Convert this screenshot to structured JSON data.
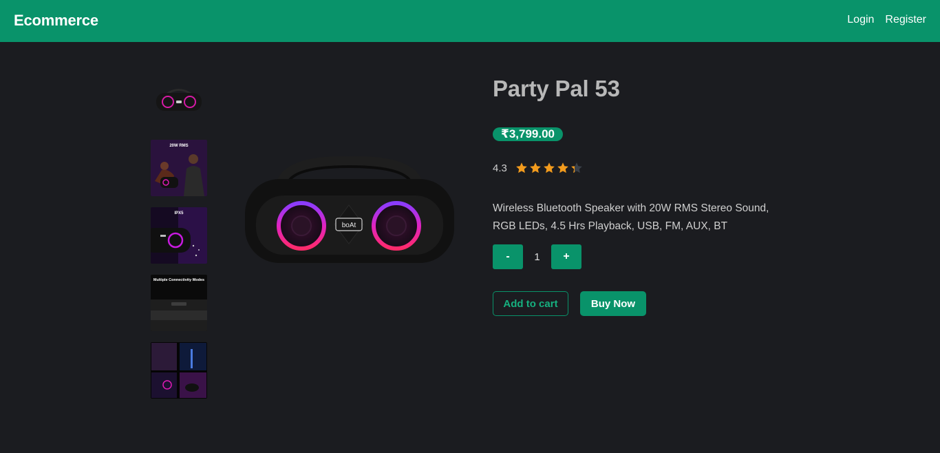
{
  "navbar": {
    "brand": "Ecommerce",
    "links": [
      "Login",
      "Register"
    ],
    "background_color": "#09936a"
  },
  "product": {
    "title": "Party Pal 53",
    "price": "₹3,799.00",
    "rating_text": "4.3",
    "rating_value": 4.3,
    "rating_max": 5,
    "description": "Wireless Bluetooth Speaker with 20W RMS Stereo Sound, RGB LEDs, 4.5 Hrs Playback, USB, FM, AUX, BT",
    "brand_logo": "boAt"
  },
  "thumbnails": [
    {
      "name": "speaker-front-view"
    },
    {
      "name": "lifestyle-20w-rms",
      "caption": "20W RMS"
    },
    {
      "name": "ipx5-water-resistant",
      "caption": "IPX5"
    },
    {
      "name": "multiple-connectivity-modes",
      "caption": "Multiple Connectivity Modes"
    },
    {
      "name": "features-collage"
    }
  ],
  "quantity": {
    "decrement_label": "-",
    "value": "1",
    "increment_label": "+"
  },
  "actions": {
    "add_to_cart": "Add to cart",
    "buy_now": "Buy Now"
  },
  "colors": {
    "accent": "#09936a",
    "background": "#1b1c20",
    "star_filled": "#f29b1d",
    "star_empty": "#3a4048"
  }
}
